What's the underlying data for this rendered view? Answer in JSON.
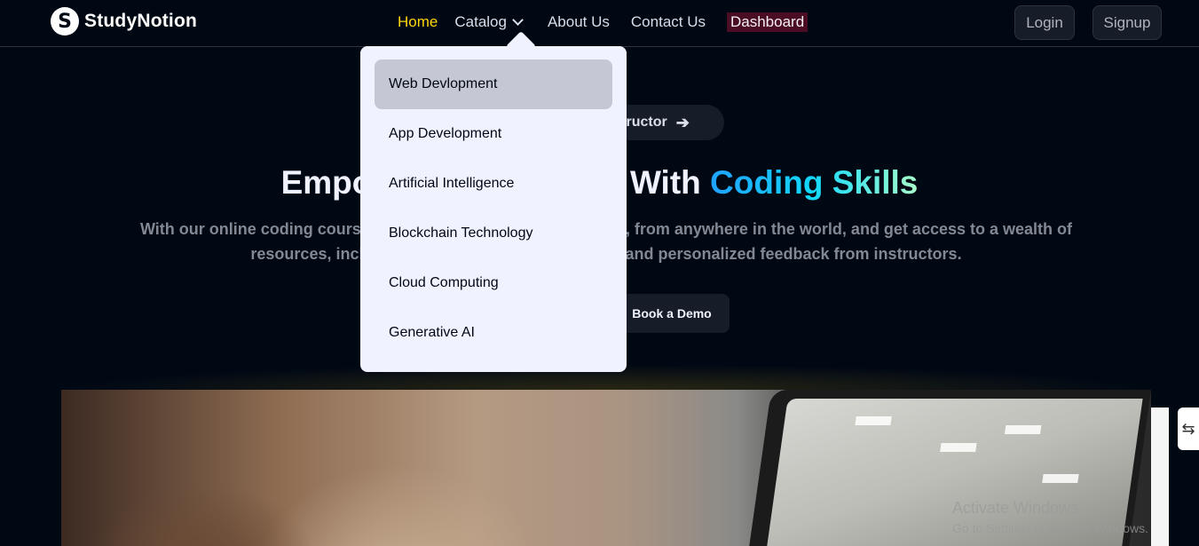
{
  "brand": {
    "logo_letter": "S",
    "name": "StudyNotion"
  },
  "nav": {
    "home": "Home",
    "catalog": "Catalog",
    "about": "About Us",
    "contact": "Contact Us",
    "dashboard": "Dashboard",
    "active": "Home"
  },
  "auth": {
    "login": "Login",
    "signup": "Signup"
  },
  "hero": {
    "instructor_pill": "Become an Instructor",
    "title_prefix": "Empower Your Future With ",
    "title_highlight": "Coding Skills",
    "description": "With our online coding courses, you can learn at your own pace, from anywhere in the world, and get access to a wealth of resources, including hands-on projects, quizzes, and personalized feedback from instructors.",
    "book_demo": "Book a Demo"
  },
  "catalog_dropdown": {
    "items": [
      {
        "label": "Web Devlopment",
        "highlighted": true
      },
      {
        "label": "App Development",
        "highlighted": false
      },
      {
        "label": "Artificial Intelligence",
        "highlighted": false
      },
      {
        "label": "Blockchain Technology",
        "highlighted": false
      },
      {
        "label": "Cloud Computing",
        "highlighted": false
      },
      {
        "label": "Generative AI",
        "highlighted": false
      }
    ]
  },
  "os_watermark": {
    "line1": "Activate Windows",
    "line2": "Go to Settings to activate Windows."
  },
  "colors": {
    "background": "#000814",
    "accent_yellow": "#ffd60a",
    "dashboard_bg": "#4a0d24",
    "highlight_blue": "#12d8fa",
    "dropdown_bg": "#f1f2ff"
  },
  "icons": {
    "catalog_chevron": "chevron-down-icon",
    "pill_arrow": "arrow-right-icon",
    "side_tab": "side-tab-icon"
  }
}
